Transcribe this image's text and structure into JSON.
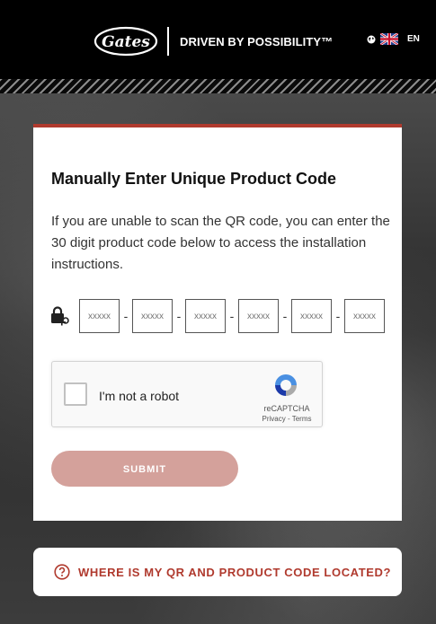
{
  "header": {
    "logo_text": "Gates",
    "tagline": "DRIVEN BY POSSIBILITY™",
    "language_code": "EN",
    "icons": [
      "globe-icon",
      "uk-flag-icon"
    ]
  },
  "form": {
    "title": "Manually Enter Unique Product Code",
    "description": "If you are unable to scan the QR code, you can enter the 30 digit product code below to access the installation instructions.",
    "code_fields": [
      {
        "placeholder": "xxxxx"
      },
      {
        "placeholder": "xxxxx"
      },
      {
        "placeholder": "xxxxx"
      },
      {
        "placeholder": "xxxxx"
      },
      {
        "placeholder": "xxxxx"
      },
      {
        "placeholder": "xxxxx"
      }
    ],
    "separator": "-",
    "captcha": {
      "label": "I'm not a robot",
      "brand": "reCAPTCHA",
      "links": "Privacy - Terms"
    },
    "submit_label": "SUBMIT"
  },
  "help": {
    "text": "WHERE IS MY QR AND PRODUCT CODE LOCATED?"
  },
  "colors": {
    "accent": "#b03a2e",
    "submit_bg": "#d4a19b",
    "header_bg": "#000000"
  }
}
